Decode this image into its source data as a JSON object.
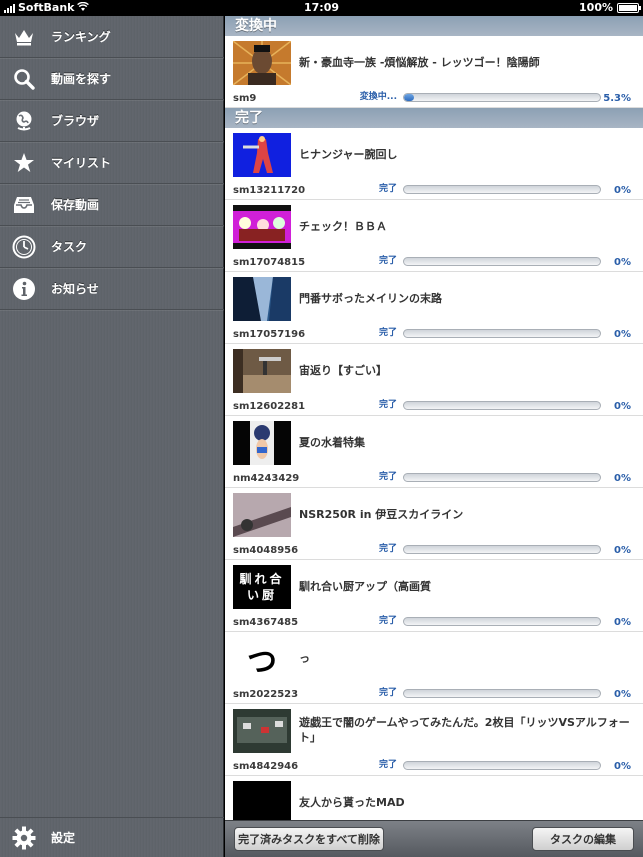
{
  "status_bar": {
    "carrier": "SoftBank",
    "time": "17:09",
    "battery": "100%"
  },
  "sidebar": {
    "items": [
      {
        "label": "ランキング",
        "icon": "crown-icon"
      },
      {
        "label": "動画を探す",
        "icon": "search-icon"
      },
      {
        "label": "ブラウザ",
        "icon": "globe-icon"
      },
      {
        "label": "マイリスト",
        "icon": "star-icon"
      },
      {
        "label": "保存動画",
        "icon": "tray-icon"
      },
      {
        "label": "タスク",
        "icon": "clock-icon"
      },
      {
        "label": "お知らせ",
        "icon": "info-icon"
      }
    ],
    "settings_label": "設定"
  },
  "sections": {
    "converting": "変換中",
    "done": "完了"
  },
  "converting_task": {
    "title": "新・豪血寺一族 -煩悩解放 - レッツゴー！陰陽師",
    "id": "sm9",
    "status": "変換中...",
    "progress": 5.3,
    "percent": "5.3%"
  },
  "done_tasks": [
    {
      "title": "ヒナンジャー腕回し",
      "id": "sm13211720",
      "status": "完了",
      "progress": 0,
      "percent": "0%"
    },
    {
      "title": "チェック！ＢＢＡ",
      "id": "sm17074815",
      "status": "完了",
      "progress": 0,
      "percent": "0%"
    },
    {
      "title": "門番サボったメイリンの末路",
      "id": "sm17057196",
      "status": "完了",
      "progress": 0,
      "percent": "0%"
    },
    {
      "title": "宙返り【すごい】",
      "id": "sm12602281",
      "status": "完了",
      "progress": 0,
      "percent": "0%"
    },
    {
      "title": "夏の水着特集",
      "id": "nm4243429",
      "status": "完了",
      "progress": 0,
      "percent": "0%"
    },
    {
      "title": "NSR250R in 伊豆スカイライン",
      "id": "sm4048956",
      "status": "完了",
      "progress": 0,
      "percent": "0%"
    },
    {
      "title": "馴れ合い厨アップ（高画質",
      "id": "sm4367485",
      "status": "完了",
      "progress": 0,
      "percent": "0%",
      "thumb_text": "馴れ合い厨"
    },
    {
      "title": "っ",
      "id": "sm2022523",
      "status": "完了",
      "progress": 0,
      "percent": "0%",
      "thumb_text": "つ"
    },
    {
      "title": "遊戯王で闇のゲームやってみたんだ。2枚目「リッツVSアルフォート」",
      "id": "sm4842946",
      "status": "完了",
      "progress": 0,
      "percent": "0%"
    },
    {
      "title": "友人から貰ったMAD"
    }
  ],
  "toolbar": {
    "clear_label": "完了済みタスクをすべて削除",
    "edit_label": "タスクの編集"
  },
  "colors": {
    "accent": "#2a5ea9",
    "section_header": "#9aaabb"
  }
}
